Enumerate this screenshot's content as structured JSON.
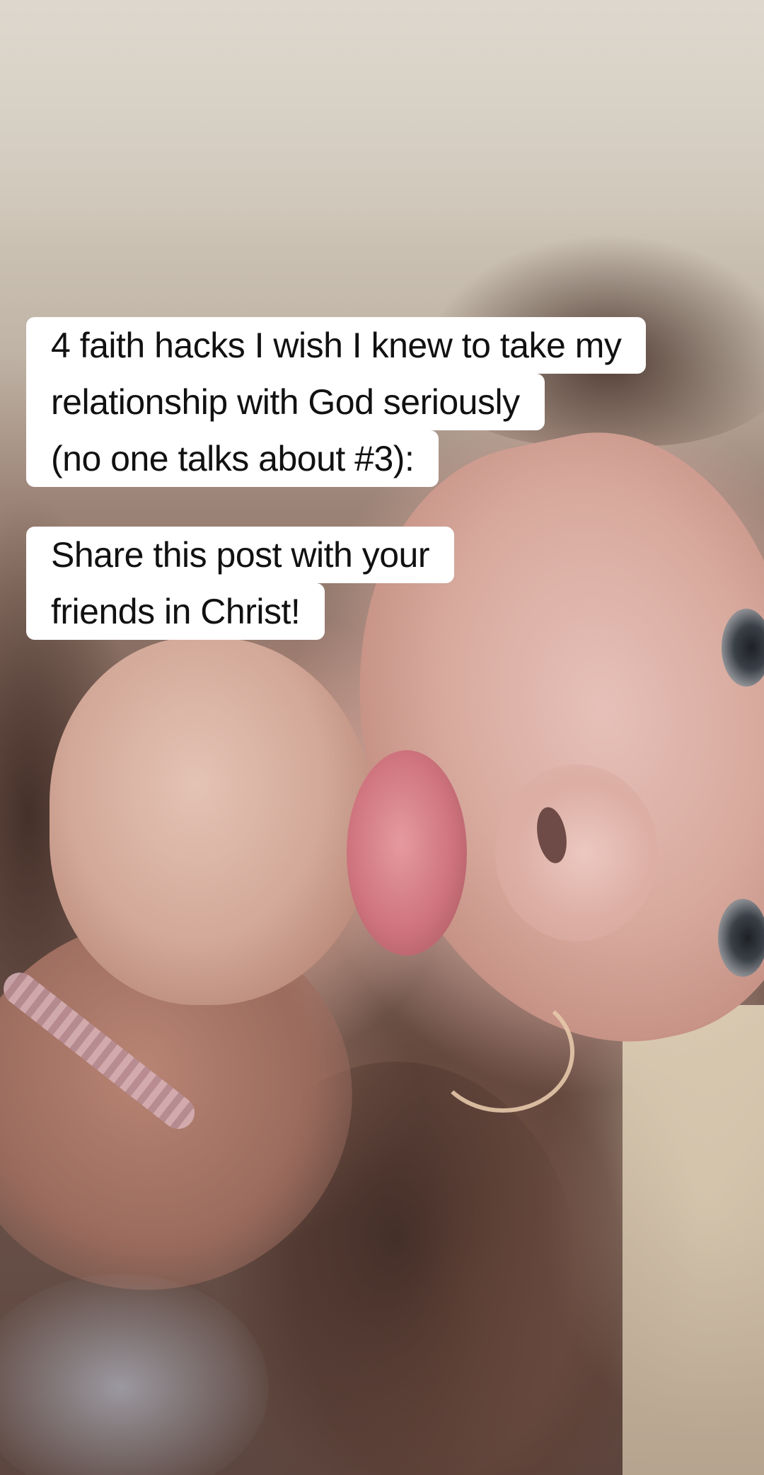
{
  "caption_primary": {
    "lines": [
      "4 faith hacks I wish I knew to take my",
      "relationship with God seriously",
      "(no one talks about #3):"
    ]
  },
  "caption_secondary": {
    "lines": [
      "Share this post with your",
      "friends in Christ!"
    ]
  },
  "colors": {
    "caption_background": "#ffffff",
    "caption_text": "#111111"
  }
}
